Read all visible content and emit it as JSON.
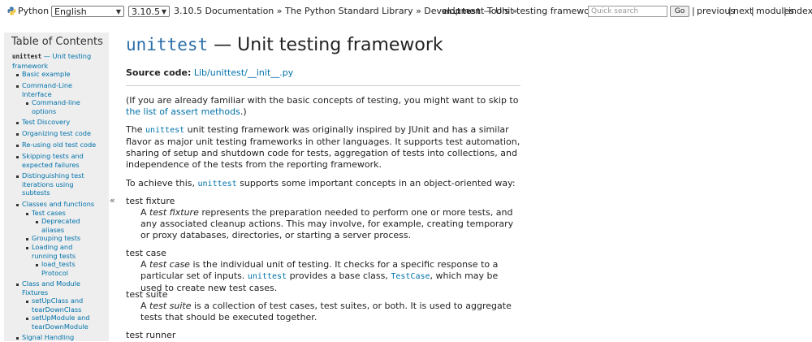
{
  "topnav": {
    "python_label": "Python »",
    "language": "English",
    "version": "3.10.5",
    "breadcrumb": "3.10.5 Documentation » The Python Standard Library » Development Tools »",
    "current_module": "unittest",
    "current_title": "— Unit testing framework",
    "search_placeholder": "Quick search",
    "go_label": "Go",
    "links": [
      "previous",
      "next",
      "modules",
      "index"
    ],
    "separator": "|"
  },
  "sidebar": {
    "title": "Table of Contents",
    "items": [
      {
        "label": "unittest",
        "suffix": "— Unit testing framework"
      },
      {
        "label": "Basic example"
      },
      {
        "label": "Command-Line Interface"
      },
      {
        "label": "Command-line options"
      },
      {
        "label": "Test Discovery"
      },
      {
        "label": "Organizing test code"
      },
      {
        "label": "Re-using old test code"
      },
      {
        "label": "Skipping tests and expected failures"
      },
      {
        "label": "Distinguishing test iterations using subtests"
      },
      {
        "label": "Classes and functions"
      },
      {
        "label": "Test cases"
      },
      {
        "label": "Deprecated aliases"
      },
      {
        "label": "Grouping tests"
      },
      {
        "label": "Loading and running tests"
      },
      {
        "label": "load_tests Protocol"
      },
      {
        "label": "Class and Module Fixtures"
      },
      {
        "label": "setUpClass and tearDownClass"
      },
      {
        "label": "setUpModule and tearDownModule"
      },
      {
        "label": "Signal Handling"
      }
    ],
    "collapse_label": "«"
  },
  "main": {
    "title_module": "unittest",
    "title_rest": "— Unit testing framework",
    "source_label": "Source code:",
    "source_link": "Lib/unittest/__init__.py",
    "intro_1": "(If you are already familiar with the basic concepts of testing, you might want to skip to",
    "intro_link": "the list of assert methods",
    "intro_2": ".)",
    "p1_a": "The",
    "p1_code": "unittest",
    "p1_b": "unit testing framework was originally inspired by JUnit and has a similar flavor as major unit testing frameworks in other languages. It supports test automation, sharing of setup and shutdown code for tests, aggregation of tests into collections, and independence of the tests from the reporting framework.",
    "p2_a": "To achieve this,",
    "p2_code": "unittest",
    "p2_b": "supports some important concepts in an object-oriented way:",
    "terms": [
      {
        "term": "test fixture",
        "def_a": "A",
        "def_em": "test fixture",
        "def_b": "represents the preparation needed to perform one or more tests, and any associated cleanup actions. This may involve, for example, creating temporary or proxy databases, directories, or starting a server process."
      },
      {
        "term": "test case",
        "def_a": "A",
        "def_em": "test case",
        "def_b": "is the individual unit of testing. It checks for a specific response to a particular set of inputs.",
        "def_code1": "unittest",
        "def_c": "provides a base class,",
        "def_code2": "TestCase",
        "def_d": ", which may be used to create new test cases."
      },
      {
        "term": "test suite",
        "def_a": "A",
        "def_em": "test suite",
        "def_b": "is a collection of test cases, test suites, or both. It is used to aggregate tests that should be executed together."
      },
      {
        "term": "test runner"
      }
    ]
  },
  "colors": {
    "link": "#0072aa",
    "sidebar_bg": "#eeeeee",
    "text": "#222222"
  }
}
